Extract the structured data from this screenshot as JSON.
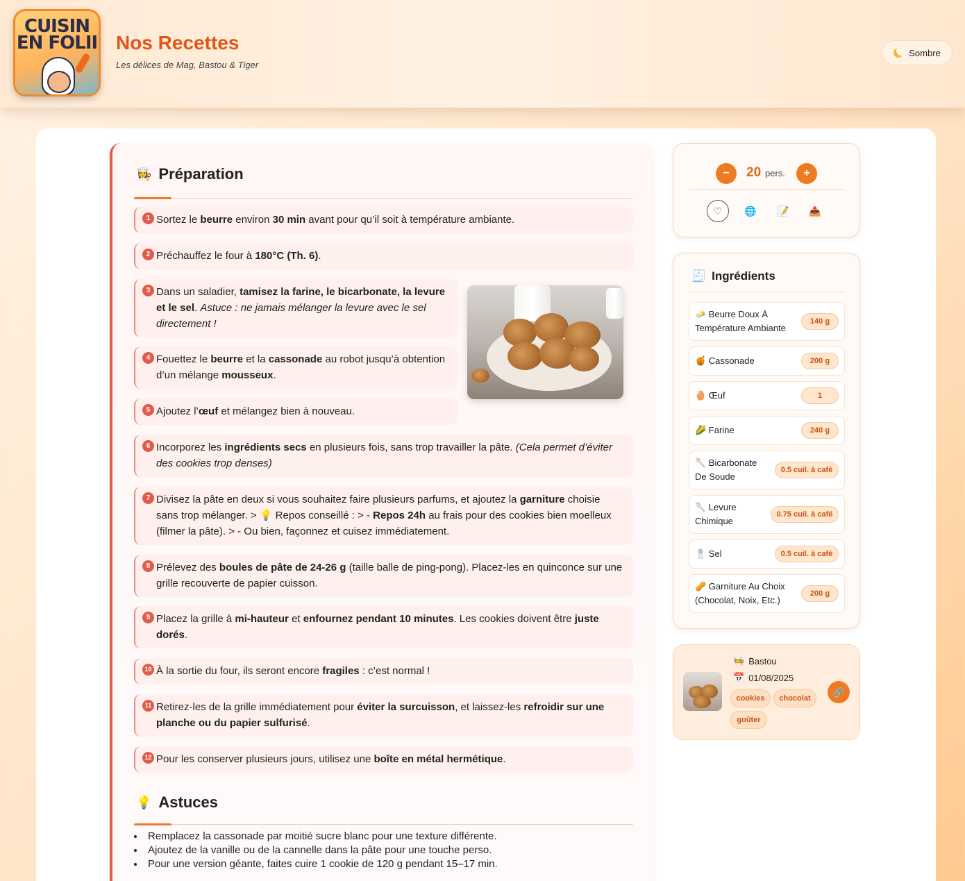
{
  "header": {
    "logo_line1": "CUISIN",
    "logo_line2": "EN FOLII",
    "title": "Nos Recettes",
    "subtitle": "Les délices de Mag, Bastou & Tiger",
    "theme_label": "Sombre"
  },
  "preparation": {
    "title": "Préparation",
    "icon": "chef-icon",
    "steps": [
      {
        "num": "1",
        "html": "Sortez le <b>beurre</b> environ <b>30 min</b> avant pour qu’il soit à température ambiante."
      },
      {
        "num": "2",
        "html": "Préchauffez le four à <b>180°C (Th. 6)</b>."
      },
      {
        "num": "3",
        "html": "Dans un saladier, <b>tamisez la farine, le bicarbonate, la levure et le sel</b>. <i>Astuce : ne jamais mélanger la levure avec le sel directement !</i>"
      },
      {
        "num": "4",
        "html": "Fouettez le <b>beurre</b> et la <b>cassonade</b> au robot jusqu’à obtention d’un mélange <b>mousseux</b>."
      },
      {
        "num": "5",
        "html": "Ajoutez l’<b>œuf</b> et mélangez bien à nouveau."
      },
      {
        "num": "6",
        "html": "Incorporez les <b>ingrédients secs</b> en plusieurs fois, sans trop travailler la pâte. <i>(Cela permet d’éviter des cookies trop denses)</i>"
      },
      {
        "num": "7",
        "html": "Divisez la pâte en deux si vous souhaitez faire plusieurs parfums, et ajoutez la <b>garniture</b> choisie sans trop mélanger. &gt; 💡 Repos conseillé : &gt; - <b>Repos 24h</b> au frais pour des cookies bien moelleux (filmer la pâte). &gt; - Ou bien, façonnez et cuisez immédiatement."
      },
      {
        "num": "8",
        "html": "Prélevez des <b>boules de pâte de 24-26 g</b> (taille balle de ping-pong). Placez-les en quinconce sur une grille recouverte de papier cuisson."
      },
      {
        "num": "9",
        "html": "Placez la grille à <b>mi-hauteur</b> et <b>enfournez pendant 10 minutes</b>. Les cookies doivent être <b>juste dorés</b>."
      },
      {
        "num": "10",
        "html": "À la sortie du four, ils seront encore <b>fragiles</b> : c’est normal !"
      },
      {
        "num": "11",
        "html": "Retirez-les de la grille immédiatement pour <b>éviter la surcuisson</b>, et laissez-les <b>refroidir sur une planche ou du papier sulfurisé</b>."
      },
      {
        "num": "12",
        "html": "Pour les conserver plusieurs jours, utilisez une <b>boîte en métal hermétique</b>."
      }
    ]
  },
  "tips": {
    "title": "Astuces",
    "icon": "lightbulb-icon",
    "items": [
      "Remplacez la cassonade par moitié sucre blanc pour une texture différente.",
      "Ajoutez de la vanille ou de la cannelle dans la pâte pour une touche perso.",
      "Pour une version géante, faites cuire 1 cookie de 120 g pendant 15–17 min."
    ]
  },
  "servings": {
    "minus": "−",
    "plus": "+",
    "count": "20",
    "unit": "pers.",
    "actions": [
      "heart-icon",
      "globe-icon",
      "notepad-icon",
      "share-icon"
    ]
  },
  "ingredients": {
    "title": "Ingrédients",
    "items": [
      {
        "icon": "🧈",
        "name": "Beurre Doux À Température Ambiante",
        "qty": "140 g"
      },
      {
        "icon": "🍯",
        "name": "Cassonade",
        "qty": "200 g"
      },
      {
        "icon": "🥚",
        "name": "Œuf",
        "qty": "1"
      },
      {
        "icon": "🌽",
        "name": "Farine",
        "qty": "240 g"
      },
      {
        "icon": "🥄",
        "name": "Bicarbonate De Soude",
        "qty": "0.5 cuil. à café"
      },
      {
        "icon": "🥄",
        "name": "Levure Chimique",
        "qty": "0.75 cuil. à café"
      },
      {
        "icon": "🧂",
        "name": "Sel",
        "qty": "0.5 cuil. à café"
      },
      {
        "icon": "🥜",
        "name": "Garniture Au Choix (Chocolat, Noix, Etc.)",
        "qty": "200 g"
      }
    ]
  },
  "meta": {
    "author": "Bastou",
    "date": "01/08/2025",
    "tags": [
      "cookies",
      "chocolat",
      "goûter"
    ]
  },
  "colors": {
    "accent": "#e2561a",
    "step_border": "#e05d4e",
    "badge_bg": "#ffe6cc"
  }
}
